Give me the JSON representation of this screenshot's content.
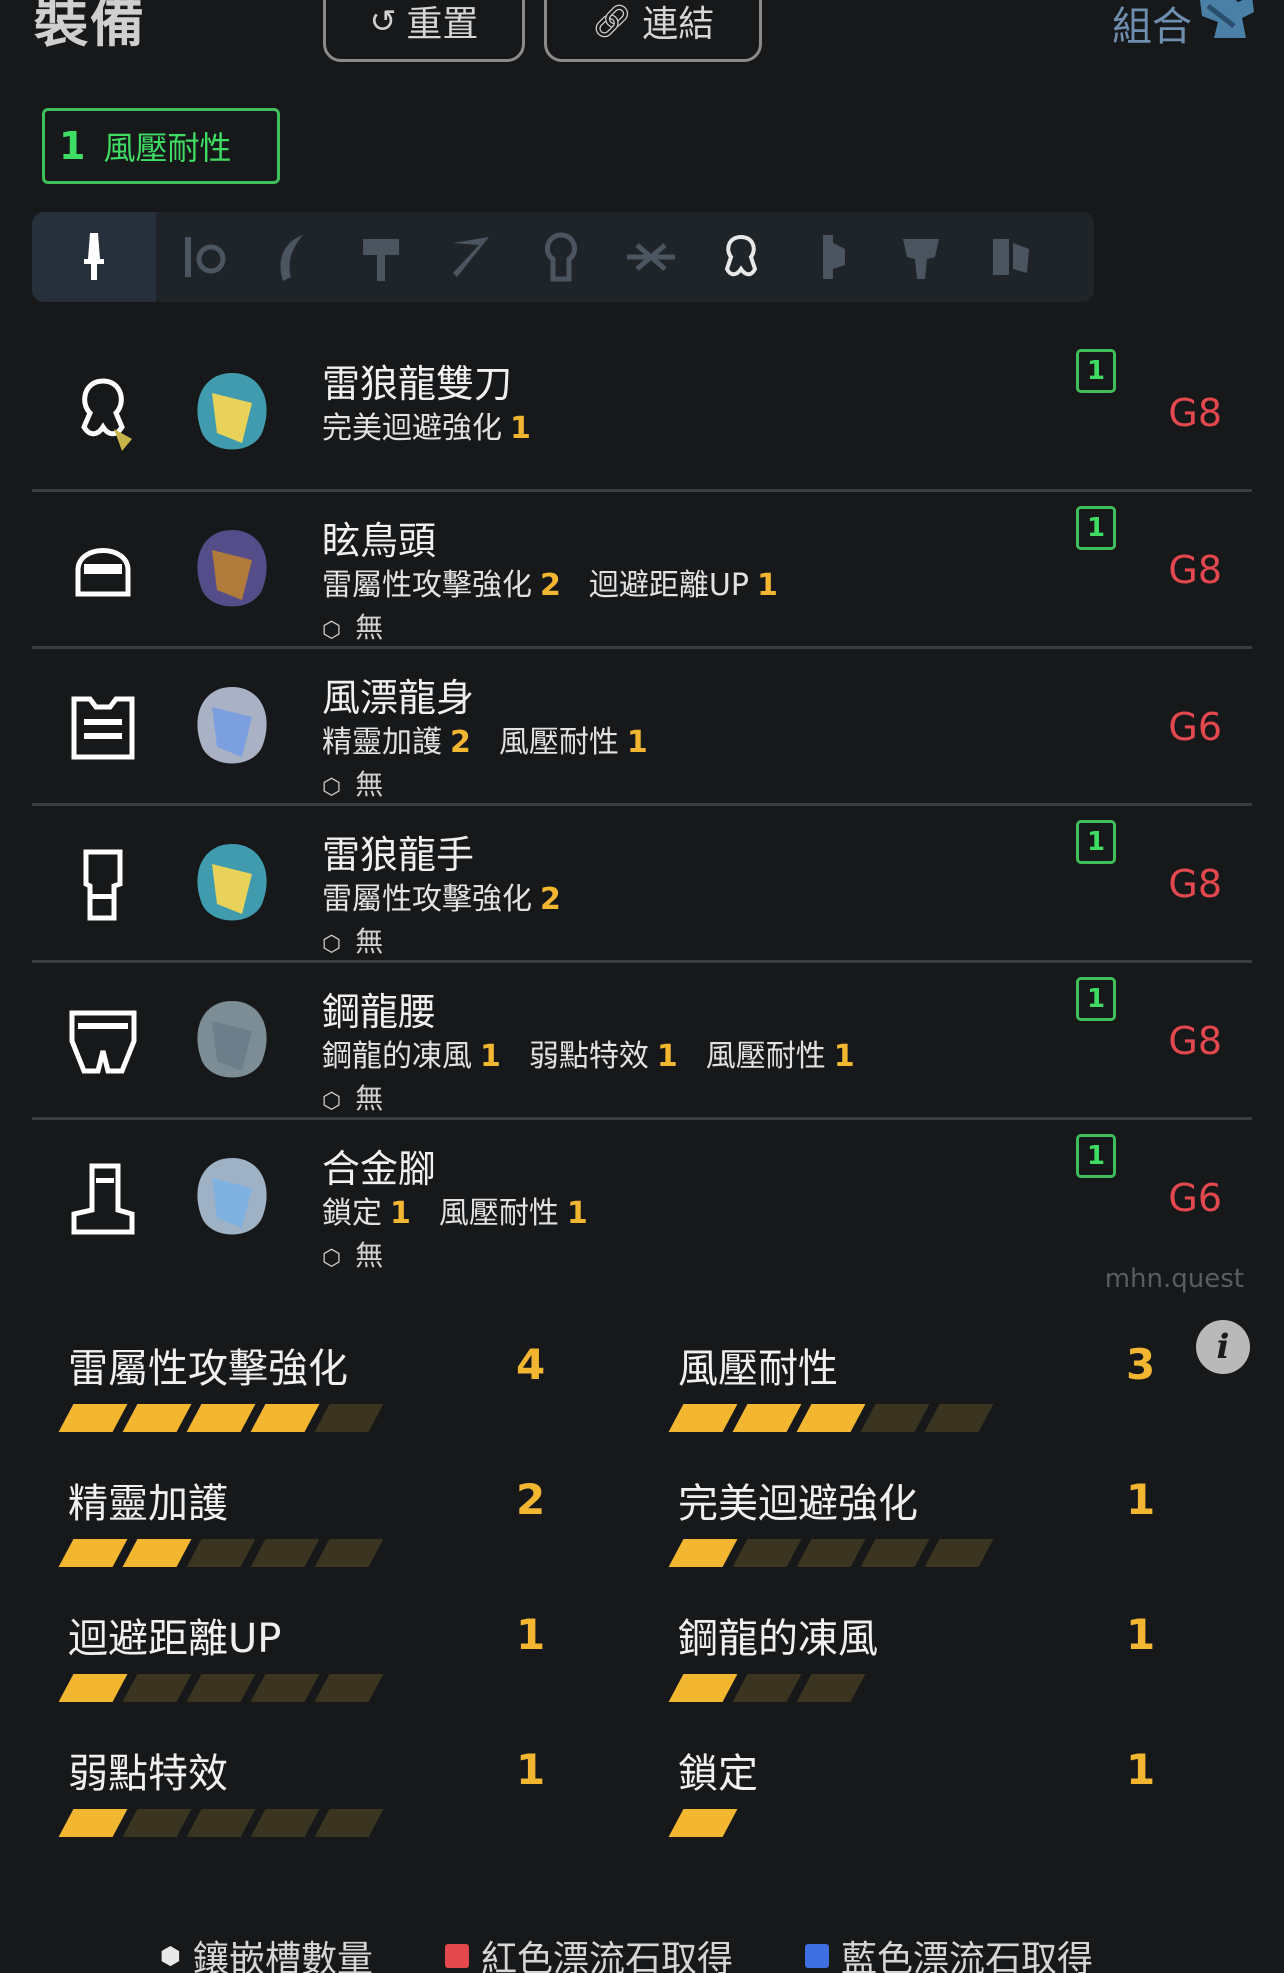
{
  "header": {
    "title": "裝備",
    "reset_label": "重置",
    "link_label": "連結",
    "combo_label": "組合"
  },
  "filter": {
    "count": "1",
    "label": "風壓耐性"
  },
  "weapons": [
    "great-sword",
    "sword-shield",
    "dual-blades",
    "hammer",
    "long-sword",
    "hunting-horn",
    "lance",
    "gunlance",
    "switch-axe",
    "charge-blade",
    "insect-glaive",
    "light-bowgun"
  ],
  "equipment": [
    {
      "name": "雷狼龍雙刀",
      "skills": [
        {
          "name": "完美迴避強化",
          "level": "1"
        }
      ],
      "slots": "",
      "badge": "1",
      "grade": "G8",
      "slot_type": "weapon-dual-blades-icon"
    },
    {
      "name": "眩鳥頭",
      "skills": [
        {
          "name": "雷屬性攻擊強化",
          "level": "2"
        },
        {
          "name": "迴避距離UP",
          "level": "1"
        }
      ],
      "slots": "無",
      "badge": "1",
      "grade": "G8",
      "slot_type": "helmet-icon"
    },
    {
      "name": "風漂龍身",
      "skills": [
        {
          "name": "精靈加護",
          "level": "2"
        },
        {
          "name": "風壓耐性",
          "level": "1"
        }
      ],
      "slots": "無",
      "badge": "",
      "grade": "G6",
      "slot_type": "chest-icon"
    },
    {
      "name": "雷狼龍手",
      "skills": [
        {
          "name": "雷屬性攻擊強化",
          "level": "2"
        }
      ],
      "slots": "無",
      "badge": "1",
      "grade": "G8",
      "slot_type": "arm-icon"
    },
    {
      "name": "鋼龍腰",
      "skills": [
        {
          "name": "鋼龍的凍風",
          "level": "1"
        },
        {
          "name": "弱點特效",
          "level": "1"
        },
        {
          "name": "風壓耐性",
          "level": "1"
        }
      ],
      "slots": "無",
      "badge": "1",
      "grade": "G8",
      "slot_type": "waist-icon"
    },
    {
      "name": "合金腳",
      "skills": [
        {
          "name": "鎖定",
          "level": "1"
        },
        {
          "name": "風壓耐性",
          "level": "1"
        }
      ],
      "slots": "無",
      "badge": "1",
      "grade": "G6",
      "slot_type": "leg-icon"
    }
  ],
  "watermark": "mhn.quest",
  "skill_summary": [
    {
      "name": "雷屬性攻擊強化",
      "level": "4",
      "value": 4,
      "max": 5
    },
    {
      "name": "風壓耐性",
      "level": "3",
      "value": 3,
      "max": 5
    },
    {
      "name": "精靈加護",
      "level": "2",
      "value": 2,
      "max": 5
    },
    {
      "name": "完美迴避強化",
      "level": "1",
      "value": 1,
      "max": 5
    },
    {
      "name": "迴避距離UP",
      "level": "1",
      "value": 1,
      "max": 5
    },
    {
      "name": "鋼龍的凍風",
      "level": "1",
      "value": 1,
      "max": 3
    },
    {
      "name": "弱點特效",
      "level": "1",
      "value": 1,
      "max": 5
    },
    {
      "name": "鎖定",
      "level": "1",
      "value": 1,
      "max": 1
    }
  ],
  "legend": {
    "slots": "鑲嵌槽數量",
    "red": "紅色漂流石取得",
    "blue": "藍色漂流石取得",
    "red_color": "#e2484d",
    "blue_color": "#3f6fe0"
  },
  "colors": {
    "accent_green": "#3fdc63",
    "level_gold": "#f2b631",
    "grade_red": "#e2484d"
  }
}
